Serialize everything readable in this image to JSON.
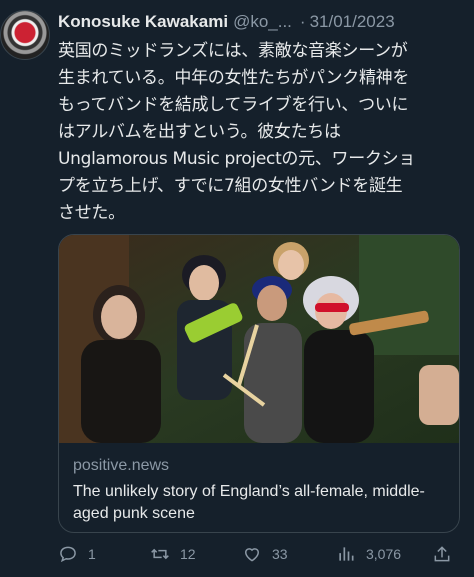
{
  "tweet": {
    "author_name": "Konosuke Kawakami",
    "author_handle": "@ko_...",
    "separator": "·",
    "date": "31/01/2023",
    "text": "英国のミッドランズには、素敵な音楽シーンが\n生まれている。中年の女性たちがパンク精神を\nもってバンドを結成してライブを行い、ついに\nはアルバムを出すという。彼女たちは\nUnglamorous Music projectの元、ワークショ\nプを立ち上げ、すでに7組の女性バンドを誕生\nさせた。"
  },
  "card": {
    "domain": "positive.news",
    "title": "The unlikely story of England’s all-female, middle-aged punk scene"
  },
  "actions": {
    "reply_count": "1",
    "retweet_count": "12",
    "like_count": "33",
    "views_count": "3,076"
  },
  "icons": {
    "reply": "reply-icon",
    "retweet": "retweet-icon",
    "like": "heart-icon",
    "views": "views-icon",
    "share": "share-icon"
  },
  "colors": {
    "background": "#15202b",
    "text": "#e7e9ea",
    "muted": "#8b98a5",
    "border": "#38444d"
  }
}
